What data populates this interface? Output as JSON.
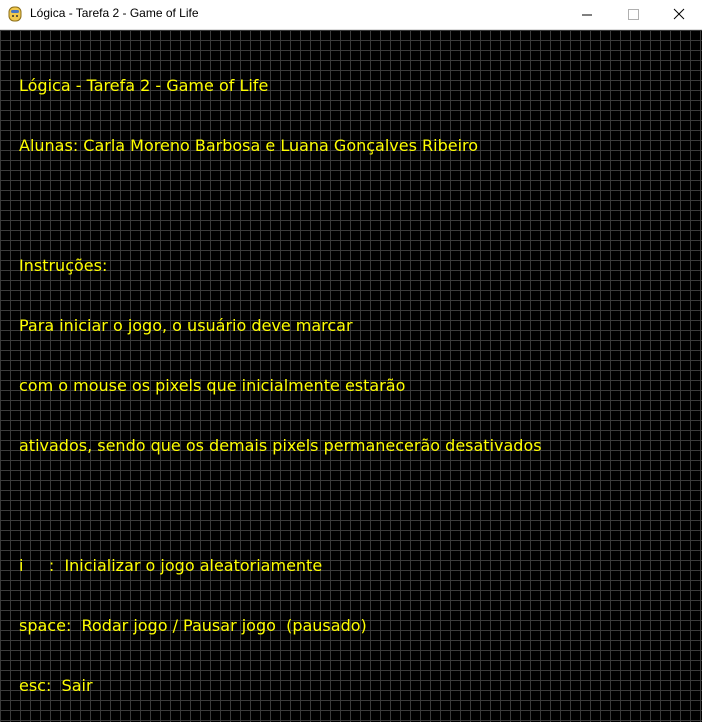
{
  "window": {
    "title": "Lógica - Tarefa 2 - Game of Life",
    "icon": "python-snake-icon",
    "controls": {
      "minimize": "minimize-icon",
      "maximize": "maximize-icon",
      "close": "close-icon"
    }
  },
  "colors": {
    "background": "#000000",
    "grid": "#3b3b3b",
    "text": "#ffff00"
  },
  "overlay": {
    "title": "Lógica - Tarefa 2 - Game of Life",
    "authors": "Alunas: Carla Moreno Barbosa e Luana Gonçalves Ribeiro",
    "instructions_heading": "Instruções:",
    "instructions": [
      "Para iniciar o jogo, o usuário deve marcar",
      "com o mouse os pixels que inicialmente estarão",
      "ativados, sendo que os demais pixels permanecerão desativados"
    ],
    "keys": [
      "i     :  Inicializar o jogo aleatoriamente",
      "space:  Rodar jogo / Pausar jogo  (pausado)",
      "esc:  Sair"
    ]
  }
}
